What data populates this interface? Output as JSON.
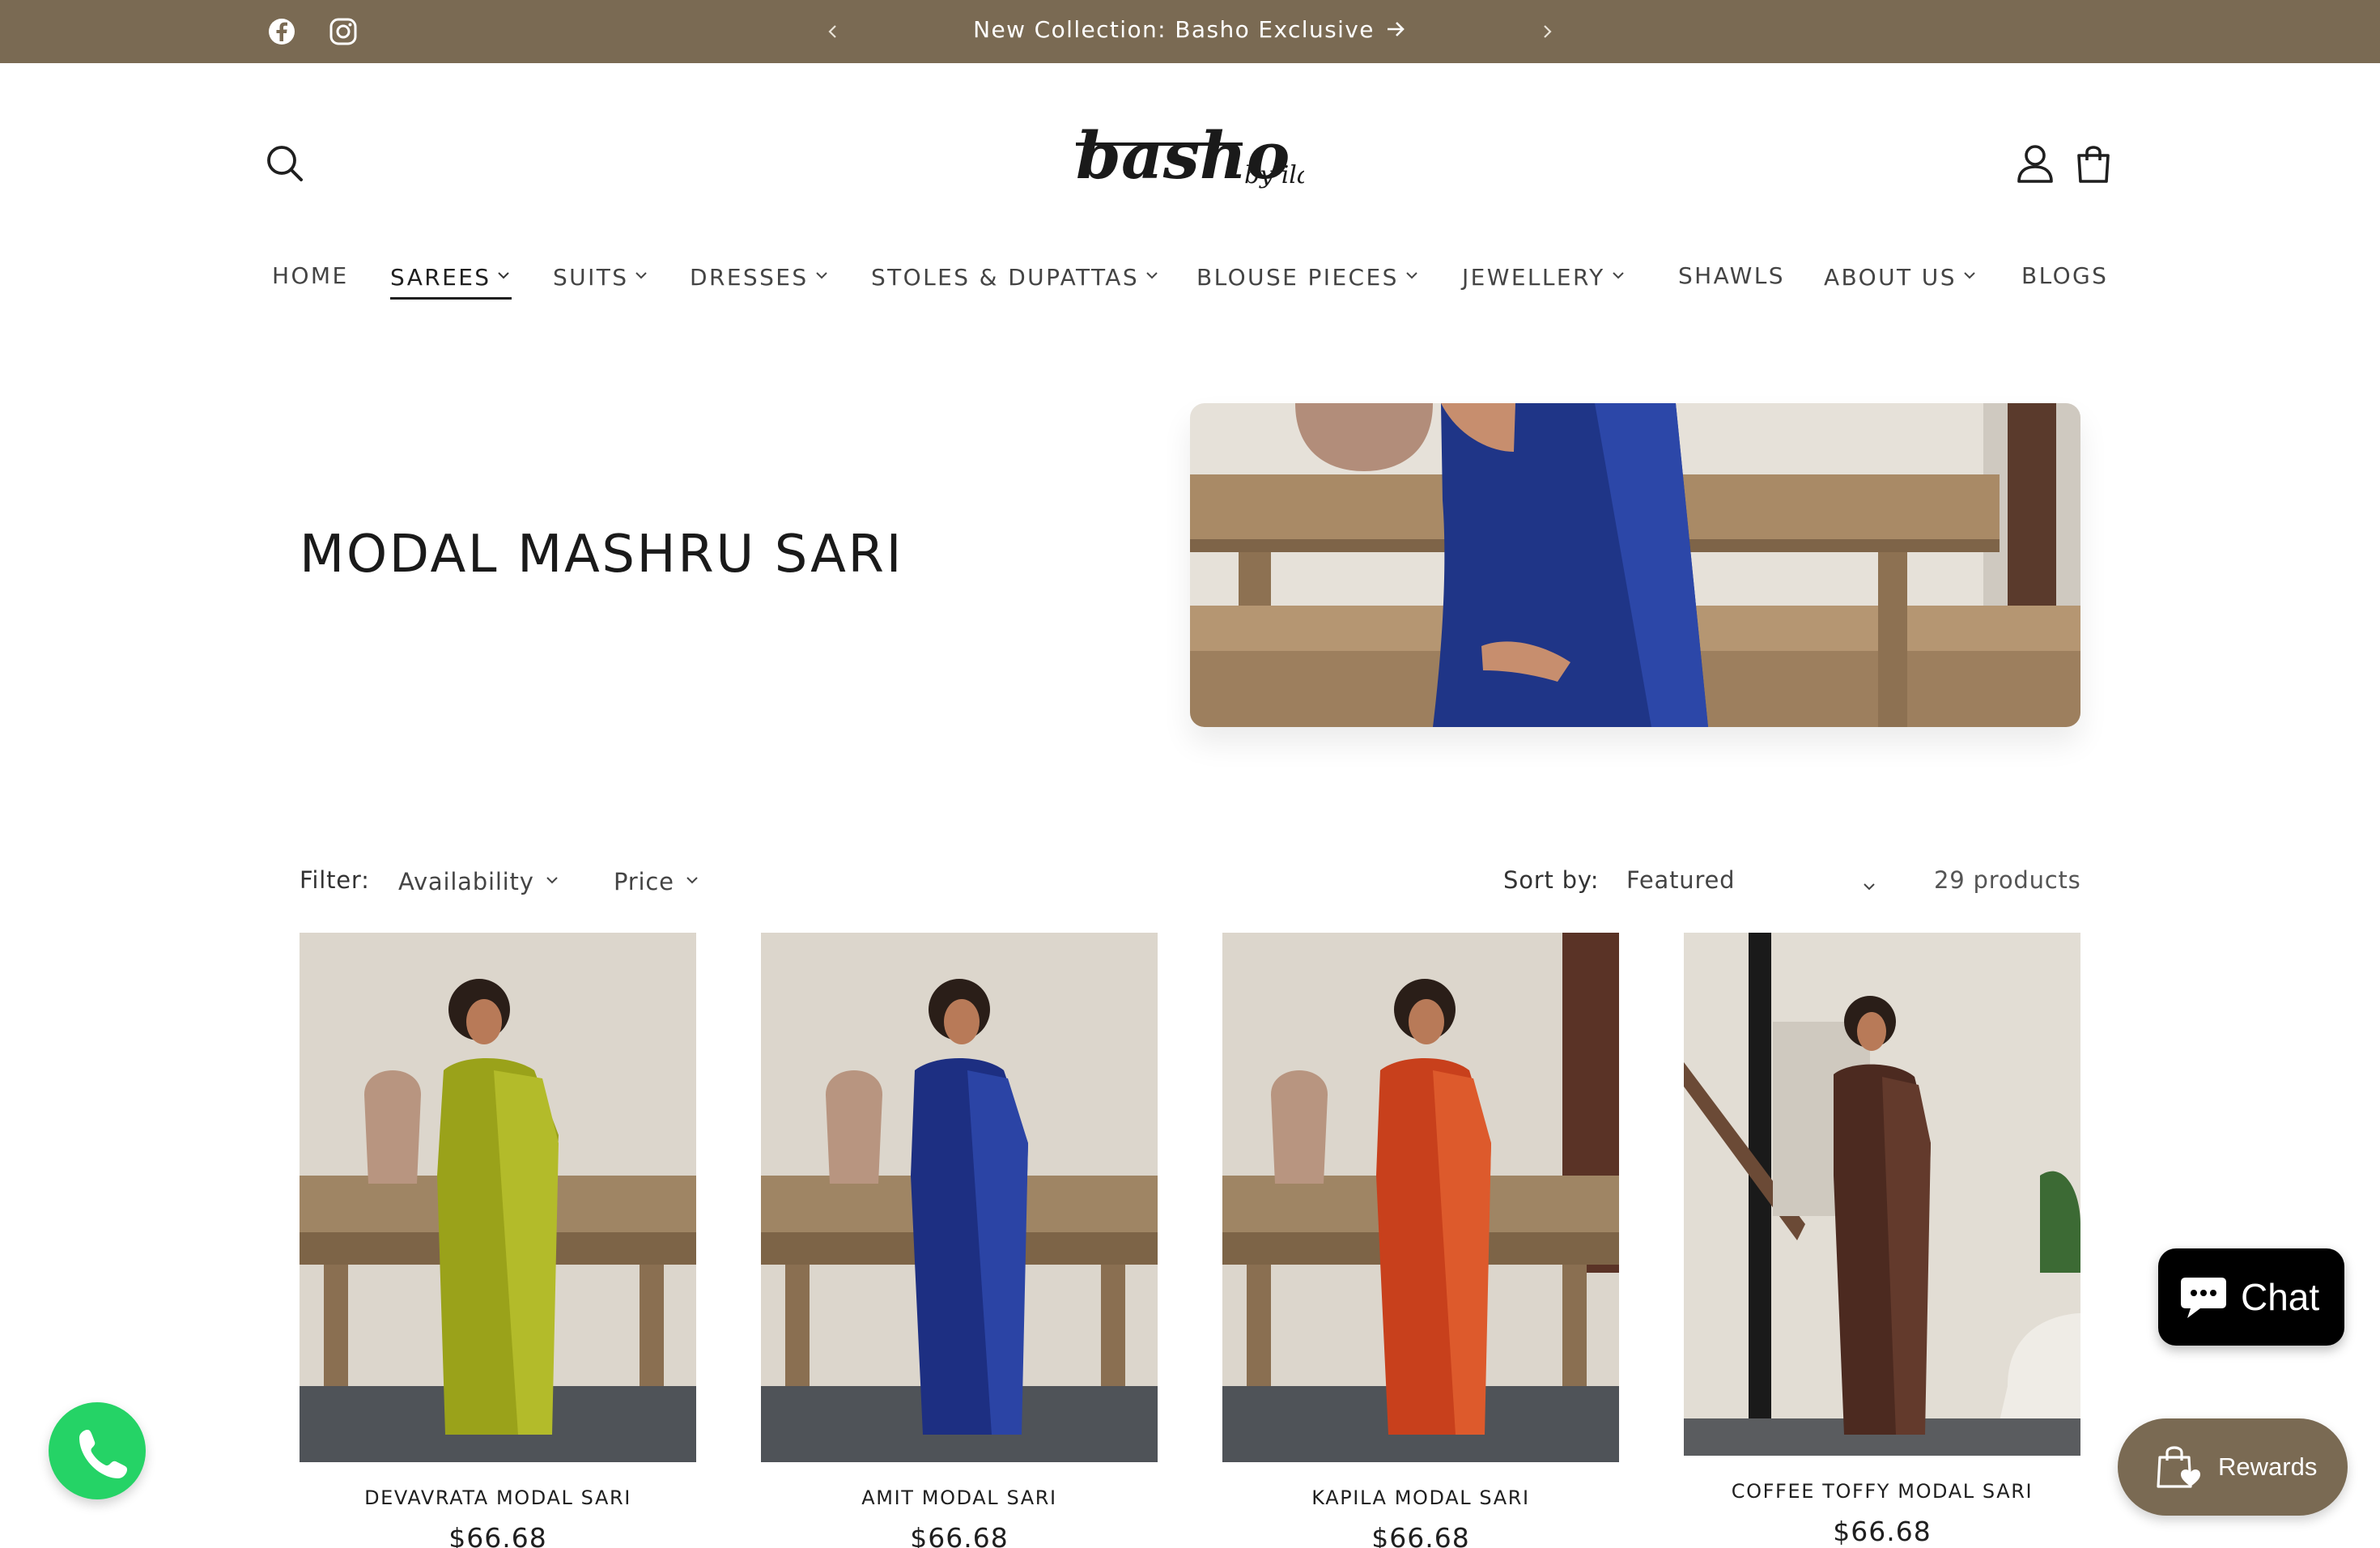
{
  "announcement": {
    "text": "New Collection: Basho Exclusive",
    "social_icons": [
      "facebook-icon",
      "instagram-icon"
    ]
  },
  "header": {
    "logo_main": "basho",
    "logo_sub": "by ila",
    "icons": [
      "search-icon",
      "account-icon",
      "cart-icon"
    ]
  },
  "nav": {
    "items": [
      {
        "label": "HOME",
        "dropdown": false
      },
      {
        "label": "SAREES",
        "dropdown": true,
        "active": true
      },
      {
        "label": "SUITS",
        "dropdown": true
      },
      {
        "label": "DRESSES",
        "dropdown": true
      },
      {
        "label": "STOLES & DUPATTAS",
        "dropdown": true
      },
      {
        "label": "BLOUSE PIECES",
        "dropdown": true
      },
      {
        "label": "JEWELLERY",
        "dropdown": true
      },
      {
        "label": "SHAWLS",
        "dropdown": false
      },
      {
        "label": "ABOUT US",
        "dropdown": true
      },
      {
        "label": "BLOGS",
        "dropdown": false
      }
    ]
  },
  "collection": {
    "title": "MODAL MASHRU SARI"
  },
  "filters": {
    "filter_label": "Filter:",
    "availability": "Availability",
    "price": "Price",
    "sort_label": "Sort by:",
    "sort_value": "Featured",
    "count": "29 products"
  },
  "products": [
    {
      "name": "DEVAVRATA MODAL SARI",
      "price": "$66.68",
      "color": "#9aa21a"
    },
    {
      "name": "AMIT MODAL SARI",
      "price": "$66.68",
      "color": "#1d2f82"
    },
    {
      "name": "KAPILA MODAL SARI",
      "price": "$66.68",
      "color": "#c8401c"
    },
    {
      "name": "COFFEE TOFFY MODAL SARI",
      "price": "$66.68",
      "color": "#4c2a20"
    }
  ],
  "widgets": {
    "chat_label": "Chat",
    "rewards_label": "Rewards"
  },
  "colors": {
    "brand": "#7a6a53",
    "text": "#1f1f1f",
    "whatsapp": "#25d366"
  }
}
